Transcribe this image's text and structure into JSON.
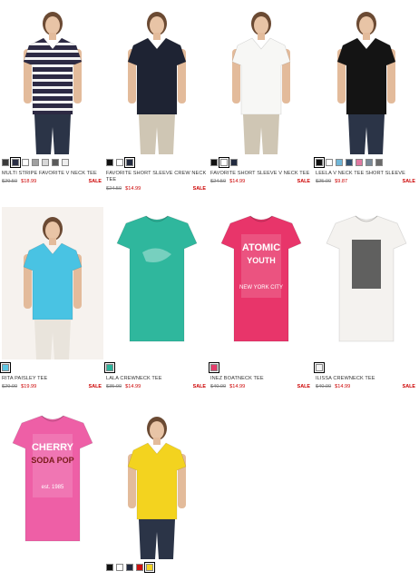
{
  "products": [
    {
      "name": "MULTI STRIPE FAVORITE V NECK TEE",
      "was": "$29.50",
      "now": "$18.99",
      "sale": "SALE",
      "colors": [
        "#3a3a3a",
        "#2a2f45",
        "#ffffff",
        "#a0a0a0",
        "#d9d9d9",
        "#5a5a5a",
        "#eeeeee"
      ],
      "selected": 1,
      "bg": "#ffffff",
      "shirt": "stripe",
      "icon": "striped-v-neck-tee-image"
    },
    {
      "name": "FAVORITE SHORT SLEEVE CREW NECK TEE",
      "was": "$24.50",
      "now": "$14.99",
      "sale": "SALE",
      "colors": [
        "#111111",
        "#ffffff",
        "#222a3f"
      ],
      "selected": 2,
      "bg": "#ffffff",
      "shirt": "#1e2333",
      "icon": "navy-crew-tee-image"
    },
    {
      "name": "FAVORITE SHORT SLEEVE V NECK TEE",
      "was": "$24.50",
      "now": "$14.99",
      "sale": "SALE",
      "colors": [
        "#111111",
        "#ffffff",
        "#222a3f"
      ],
      "selected": 1,
      "bg": "#ffffff",
      "shirt": "#f7f7f5",
      "icon": "white-v-neck-tee-image"
    },
    {
      "name": "LEELA V NECK TEE SHORT SLEEVE",
      "was": "$25.00",
      "now": "$9.87",
      "sale": "SALE",
      "colors": [
        "#111111",
        "#ffffff",
        "#6fb6d8",
        "#2f4f6f",
        "#e07aa2",
        "#7a8a98",
        "#6a6a6a"
      ],
      "selected": 0,
      "bg": "#ffffff",
      "shirt": "#141414",
      "icon": "black-v-neck-tee-image"
    },
    {
      "name": "RITA PAISLEY TEE",
      "was": "$29.00",
      "now": "$19.99",
      "sale": "SALE",
      "colors": [
        "#5cc6e4"
      ],
      "selected": 0,
      "bg": "#f6f2ee",
      "shirt": "#49c3e3",
      "icon": "aqua-paisley-tee-image"
    },
    {
      "name": "LALA CREWNECK TEE",
      "was": "$35.00",
      "now": "$14.99",
      "sale": "SALE",
      "colors": [
        "#2bb39a"
      ],
      "selected": 0,
      "bg": "#ffffff",
      "shirt": "#2fb79d",
      "icon": "green-crewneck-tee-image"
    },
    {
      "name": "INEZ BOATNECK TEE",
      "was": "$40.00",
      "now": "$14.99",
      "sale": "SALE",
      "colors": [
        "#e53d6b"
      ],
      "selected": 0,
      "bg": "#ffffff",
      "shirt": "#e8356a",
      "icon": "pink-atomic-youth-tee-image",
      "print": [
        "ATOMIC",
        "YOUTH",
        "NEW YORK CITY"
      ]
    },
    {
      "name": "ILISSA CREWNECK TEE",
      "was": "$40.00",
      "now": "$14.99",
      "sale": "SALE",
      "colors": [
        "#f4f4f4"
      ],
      "selected": 0,
      "bg": "#ffffff",
      "shirt": "#f4f2ef",
      "icon": "white-graphic-tee-image"
    },
    {
      "name": "",
      "was": "",
      "now": "",
      "sale": "",
      "colors": [],
      "selected": -1,
      "bg": "#ffffff",
      "shirt": "#ee5fa6",
      "icon": "pink-cherry-soda-tee-image",
      "print": [
        "CHERRY",
        "SODA POP",
        "est. 1985"
      ]
    },
    {
      "name": "",
      "was": "",
      "now": "",
      "sale": "",
      "colors": [
        "#111111",
        "#ffffff",
        "#222a3f",
        "#cc1111",
        "#f2d322"
      ],
      "selected": 4,
      "bg": "#ffffff",
      "shirt": "#f3d31f",
      "icon": "yellow-v-neck-tee-image"
    }
  ]
}
